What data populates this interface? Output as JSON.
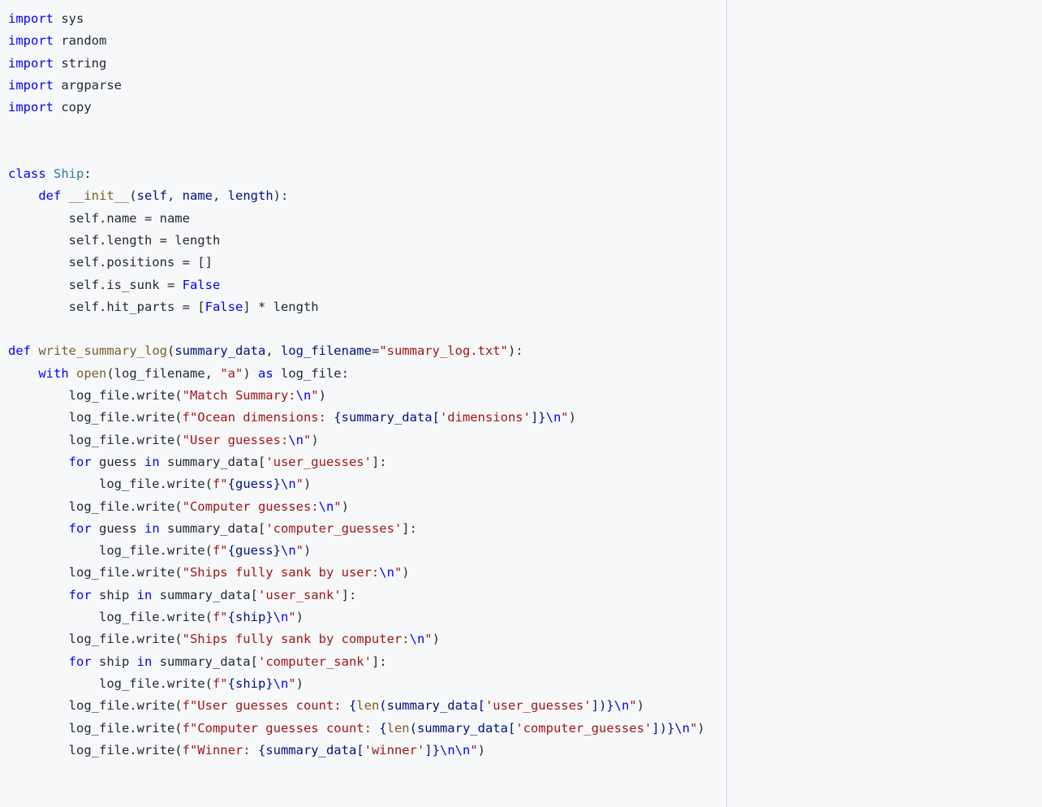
{
  "code": {
    "lines": [
      [
        {
          "t": "import",
          "c": "kw"
        },
        {
          "t": " sys"
        }
      ],
      [
        {
          "t": "import",
          "c": "kw"
        },
        {
          "t": " random"
        }
      ],
      [
        {
          "t": "import",
          "c": "kw"
        },
        {
          "t": " string"
        }
      ],
      [
        {
          "t": "import",
          "c": "kw"
        },
        {
          "t": " argparse"
        }
      ],
      [
        {
          "t": "import",
          "c": "kw"
        },
        {
          "t": " copy"
        }
      ],
      [],
      [],
      [
        {
          "t": "class",
          "c": "kw"
        },
        {
          "t": " "
        },
        {
          "t": "Ship",
          "c": "name"
        },
        {
          "t": ":"
        }
      ],
      [
        {
          "t": "    "
        },
        {
          "t": "def",
          "c": "kw"
        },
        {
          "t": " "
        },
        {
          "t": "__init__",
          "c": "func"
        },
        {
          "t": "("
        },
        {
          "t": "self",
          "c": "var"
        },
        {
          "t": ", "
        },
        {
          "t": "name",
          "c": "var"
        },
        {
          "t": ", "
        },
        {
          "t": "length",
          "c": "var"
        },
        {
          "t": "):"
        }
      ],
      [
        {
          "t": "        self.name = name"
        }
      ],
      [
        {
          "t": "        self.length = length"
        }
      ],
      [
        {
          "t": "        self.positions = []"
        }
      ],
      [
        {
          "t": "        self.is_sunk = "
        },
        {
          "t": "False",
          "c": "cons"
        }
      ],
      [
        {
          "t": "        self.hit_parts = ["
        },
        {
          "t": "False",
          "c": "cons"
        },
        {
          "t": "] * length"
        }
      ],
      [],
      [
        {
          "t": "def",
          "c": "kw"
        },
        {
          "t": " "
        },
        {
          "t": "write_summary_log",
          "c": "func"
        },
        {
          "t": "("
        },
        {
          "t": "summary_data",
          "c": "var"
        },
        {
          "t": ", "
        },
        {
          "t": "log_filename",
          "c": "var"
        },
        {
          "t": "="
        },
        {
          "t": "\"summary_log.txt\"",
          "c": "str"
        },
        {
          "t": "):"
        }
      ],
      [
        {
          "t": "    "
        },
        {
          "t": "with",
          "c": "kw"
        },
        {
          "t": " "
        },
        {
          "t": "open",
          "c": "func"
        },
        {
          "t": "(log_filename, "
        },
        {
          "t": "\"a\"",
          "c": "str"
        },
        {
          "t": ") "
        },
        {
          "t": "as",
          "c": "kw"
        },
        {
          "t": " log_file:"
        }
      ],
      [
        {
          "t": "        log_file.write("
        },
        {
          "t": "\"Match Summary:",
          "c": "str"
        },
        {
          "t": "\\n",
          "c": "esc"
        },
        {
          "t": "\"",
          "c": "str"
        },
        {
          "t": ")"
        }
      ],
      [
        {
          "t": "        log_file.write("
        },
        {
          "t": "f\"Ocean dimensions: ",
          "c": "str"
        },
        {
          "t": "{",
          "c": "var"
        },
        {
          "t": "summary_data[",
          "c": "var"
        },
        {
          "t": "'dimensions'",
          "c": "str"
        },
        {
          "t": "]",
          "c": "var"
        },
        {
          "t": "}",
          "c": "var"
        },
        {
          "t": "\\n",
          "c": "esc"
        },
        {
          "t": "\"",
          "c": "str"
        },
        {
          "t": ")"
        }
      ],
      [
        {
          "t": "        log_file.write("
        },
        {
          "t": "\"User guesses:",
          "c": "str"
        },
        {
          "t": "\\n",
          "c": "esc"
        },
        {
          "t": "\"",
          "c": "str"
        },
        {
          "t": ")"
        }
      ],
      [
        {
          "t": "        "
        },
        {
          "t": "for",
          "c": "kw"
        },
        {
          "t": " guess "
        },
        {
          "t": "in",
          "c": "kw"
        },
        {
          "t": " summary_data["
        },
        {
          "t": "'user_guesses'",
          "c": "str"
        },
        {
          "t": "]:"
        }
      ],
      [
        {
          "t": "            log_file.write("
        },
        {
          "t": "f\"",
          "c": "str"
        },
        {
          "t": "{",
          "c": "var"
        },
        {
          "t": "guess",
          "c": "var"
        },
        {
          "t": "}",
          "c": "var"
        },
        {
          "t": "\\n",
          "c": "esc"
        },
        {
          "t": "\"",
          "c": "str"
        },
        {
          "t": ")"
        }
      ],
      [
        {
          "t": "        log_file.write("
        },
        {
          "t": "\"Computer guesses:",
          "c": "str"
        },
        {
          "t": "\\n",
          "c": "esc"
        },
        {
          "t": "\"",
          "c": "str"
        },
        {
          "t": ")"
        }
      ],
      [
        {
          "t": "        "
        },
        {
          "t": "for",
          "c": "kw"
        },
        {
          "t": " guess "
        },
        {
          "t": "in",
          "c": "kw"
        },
        {
          "t": " summary_data["
        },
        {
          "t": "'computer_guesses'",
          "c": "str"
        },
        {
          "t": "]:"
        }
      ],
      [
        {
          "t": "            log_file.write("
        },
        {
          "t": "f\"",
          "c": "str"
        },
        {
          "t": "{",
          "c": "var"
        },
        {
          "t": "guess",
          "c": "var"
        },
        {
          "t": "}",
          "c": "var"
        },
        {
          "t": "\\n",
          "c": "esc"
        },
        {
          "t": "\"",
          "c": "str"
        },
        {
          "t": ")"
        }
      ],
      [
        {
          "t": "        log_file.write("
        },
        {
          "t": "\"Ships fully sank by user:",
          "c": "str"
        },
        {
          "t": "\\n",
          "c": "esc"
        },
        {
          "t": "\"",
          "c": "str"
        },
        {
          "t": ")"
        }
      ],
      [
        {
          "t": "        "
        },
        {
          "t": "for",
          "c": "kw"
        },
        {
          "t": " ship "
        },
        {
          "t": "in",
          "c": "kw"
        },
        {
          "t": " summary_data["
        },
        {
          "t": "'user_sank'",
          "c": "str"
        },
        {
          "t": "]:"
        }
      ],
      [
        {
          "t": "            log_file.write("
        },
        {
          "t": "f\"",
          "c": "str"
        },
        {
          "t": "{",
          "c": "var"
        },
        {
          "t": "ship",
          "c": "var"
        },
        {
          "t": "}",
          "c": "var"
        },
        {
          "t": "\\n",
          "c": "esc"
        },
        {
          "t": "\"",
          "c": "str"
        },
        {
          "t": ")"
        }
      ],
      [
        {
          "t": "        log_file.write("
        },
        {
          "t": "\"Ships fully sank by computer:",
          "c": "str"
        },
        {
          "t": "\\n",
          "c": "esc"
        },
        {
          "t": "\"",
          "c": "str"
        },
        {
          "t": ")"
        }
      ],
      [
        {
          "t": "        "
        },
        {
          "t": "for",
          "c": "kw"
        },
        {
          "t": " ship "
        },
        {
          "t": "in",
          "c": "kw"
        },
        {
          "t": " summary_data["
        },
        {
          "t": "'computer_sank'",
          "c": "str"
        },
        {
          "t": "]:"
        }
      ],
      [
        {
          "t": "            log_file.write("
        },
        {
          "t": "f\"",
          "c": "str"
        },
        {
          "t": "{",
          "c": "var"
        },
        {
          "t": "ship",
          "c": "var"
        },
        {
          "t": "}",
          "c": "var"
        },
        {
          "t": "\\n",
          "c": "esc"
        },
        {
          "t": "\"",
          "c": "str"
        },
        {
          "t": ")"
        }
      ],
      [
        {
          "t": "        log_file.write("
        },
        {
          "t": "f\"User guesses count: ",
          "c": "str"
        },
        {
          "t": "{",
          "c": "var"
        },
        {
          "t": "len",
          "c": "func"
        },
        {
          "t": "(summary_data[",
          "c": "var"
        },
        {
          "t": "'user_guesses'",
          "c": "str"
        },
        {
          "t": "])",
          "c": "var"
        },
        {
          "t": "}",
          "c": "var"
        },
        {
          "t": "\\n",
          "c": "esc"
        },
        {
          "t": "\"",
          "c": "str"
        },
        {
          "t": ")"
        }
      ],
      [
        {
          "t": "        log_file.write("
        },
        {
          "t": "f\"Computer guesses count: ",
          "c": "str"
        },
        {
          "t": "{",
          "c": "var"
        },
        {
          "t": "len",
          "c": "func"
        },
        {
          "t": "(summary_data[",
          "c": "var"
        },
        {
          "t": "'computer_guesses'",
          "c": "str"
        },
        {
          "t": "])",
          "c": "var"
        },
        {
          "t": "}",
          "c": "var"
        },
        {
          "t": "\\n",
          "c": "esc"
        },
        {
          "t": "\"",
          "c": "str"
        },
        {
          "t": ")"
        }
      ],
      [
        {
          "t": "        log_file.write("
        },
        {
          "t": "f\"Winner: ",
          "c": "str"
        },
        {
          "t": "{",
          "c": "var"
        },
        {
          "t": "summary_data[",
          "c": "var"
        },
        {
          "t": "'winner'",
          "c": "str"
        },
        {
          "t": "]",
          "c": "var"
        },
        {
          "t": "}",
          "c": "var"
        },
        {
          "t": "\\n\\n",
          "c": "esc"
        },
        {
          "t": "\"",
          "c": "str"
        },
        {
          "t": ")"
        }
      ]
    ]
  }
}
